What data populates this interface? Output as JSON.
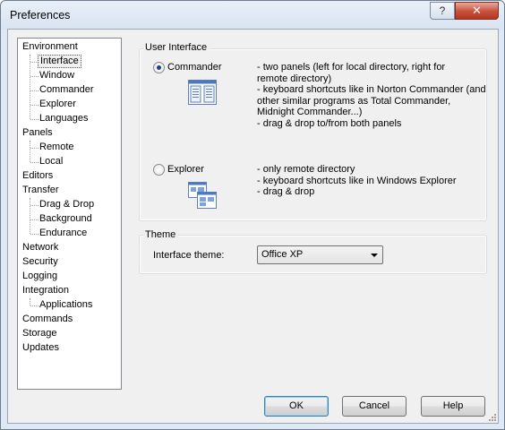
{
  "window": {
    "title": "Preferences",
    "help_glyph": "?",
    "close_glyph": "✕"
  },
  "tree": {
    "items": [
      {
        "label": "Environment",
        "level": 0
      },
      {
        "label": "Interface",
        "level": 1,
        "selected": true
      },
      {
        "label": "Window",
        "level": 1
      },
      {
        "label": "Commander",
        "level": 1
      },
      {
        "label": "Explorer",
        "level": 1
      },
      {
        "label": "Languages",
        "level": 1
      },
      {
        "label": "Panels",
        "level": 0
      },
      {
        "label": "Remote",
        "level": 1
      },
      {
        "label": "Local",
        "level": 1
      },
      {
        "label": "Editors",
        "level": 0
      },
      {
        "label": "Transfer",
        "level": 0
      },
      {
        "label": "Drag & Drop",
        "level": 1
      },
      {
        "label": "Background",
        "level": 1
      },
      {
        "label": "Endurance",
        "level": 1
      },
      {
        "label": "Network",
        "level": 0
      },
      {
        "label": "Security",
        "level": 0
      },
      {
        "label": "Logging",
        "level": 0
      },
      {
        "label": "Integration",
        "level": 0
      },
      {
        "label": "Applications",
        "level": 1
      },
      {
        "label": "Commands",
        "level": 0
      },
      {
        "label": "Storage",
        "level": 0
      },
      {
        "label": "Updates",
        "level": 0
      }
    ]
  },
  "user_interface": {
    "group_label": "User Interface",
    "commander": {
      "label": "Commander",
      "checked": true,
      "icon": "commander-layout-icon",
      "description": [
        "- two panels (left for local directory, right for",
        "remote directory)",
        "- keyboard shortcuts like in Norton Commander (and",
        "other similar programs as Total Commander,",
        "Midnight Commander...)",
        "- drag & drop to/from both panels"
      ]
    },
    "explorer": {
      "label": "Explorer",
      "checked": false,
      "icon": "explorer-layout-icon",
      "description": [
        "- only remote directory",
        "- keyboard shortcuts like in Windows Explorer",
        "- drag & drop"
      ]
    }
  },
  "theme": {
    "group_label": "Theme",
    "field_label": "Interface theme:",
    "value": "Office XP"
  },
  "buttons": {
    "ok": "OK",
    "cancel": "Cancel",
    "help": "Help"
  },
  "colors": {
    "selection_accent": "#3c7fb1",
    "title_gradient": "#d9e4f2",
    "close_red": "#c7503a"
  }
}
